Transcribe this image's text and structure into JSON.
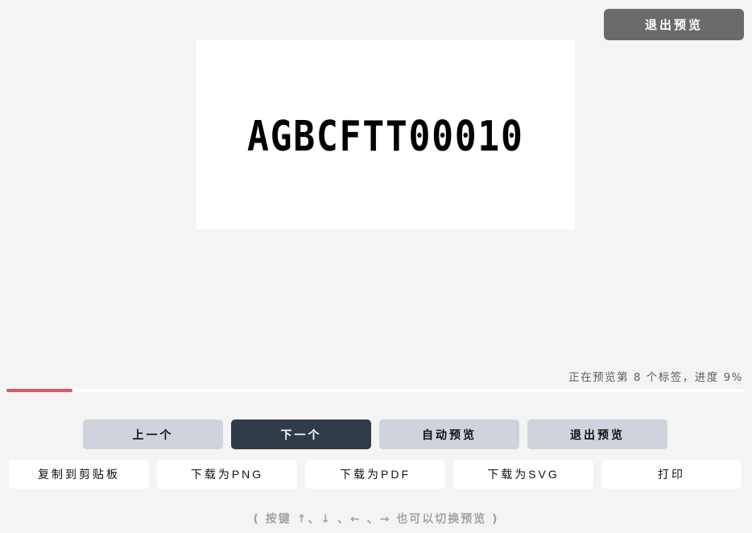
{
  "header": {
    "exit_label": "退出预览"
  },
  "preview": {
    "label_text": "AGBCFTT00010"
  },
  "status": {
    "text": "正在预览第 8 个标签，进度 9%",
    "progress": 0.09,
    "accent_color": "#e0566a"
  },
  "nav_buttons": [
    {
      "label": "上一个"
    },
    {
      "label": "下一个"
    },
    {
      "label": "自动预览"
    },
    {
      "label": "退出预览"
    }
  ],
  "action_buttons": [
    {
      "label": "复制到剪贴板"
    },
    {
      "label": "下载为PNG"
    },
    {
      "label": "下载为PDF"
    },
    {
      "label": "下载为SVG"
    },
    {
      "label": "打印"
    }
  ],
  "hint": {
    "text": "( 按键 ↑、↓ 、← 、→ 也可以切换预览 )"
  }
}
